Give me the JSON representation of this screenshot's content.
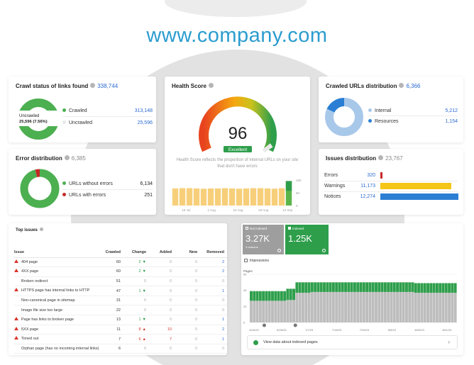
{
  "site": {
    "title": "www.company.com"
  },
  "crawl_status": {
    "title": "Crawl status of links found",
    "total": "338,744",
    "donut_label": "Uncrawled",
    "donut_value": "25,596 (7.56%)",
    "items": [
      {
        "label": "Crawled",
        "value": "313,148",
        "color": "#4caf50"
      },
      {
        "label": "Uncrawled",
        "value": "25,596",
        "color": "#e8e8e8"
      }
    ]
  },
  "health": {
    "title": "Health Score",
    "score": "96",
    "badge": "Excellent",
    "description": "Health Score reflects the proportion of internal URLs on your site that don't have errors",
    "chart_data": {
      "type": "bar",
      "values": [
        67,
        68,
        68,
        67,
        66,
        67,
        67,
        68,
        67,
        66,
        67,
        68,
        68,
        67,
        66,
        68,
        96
      ],
      "ylim": [
        0,
        100
      ],
      "yticks": [
        "100",
        "50",
        "0"
      ],
      "xticks": [
        "19 Jul",
        "1 Aug",
        "15 Aug",
        "29 Aug",
        "12 Sep"
      ]
    }
  },
  "crawled_urls": {
    "title": "Crawled URLs distribution",
    "total": "6,366",
    "items": [
      {
        "label": "Internal",
        "value": "5,212",
        "color": "#a8c8ea"
      },
      {
        "label": "Resources",
        "value": "1,154",
        "color": "#2a7fd4"
      }
    ],
    "fractions": [
      0.819,
      0.181
    ]
  },
  "error_dist": {
    "title": "Error distribution",
    "total": "6,385",
    "items": [
      {
        "label": "URLs without errors",
        "value": "6,134",
        "color": "#4caf50"
      },
      {
        "label": "URLs with errors",
        "value": "251",
        "color": "#c62828"
      }
    ],
    "fractions": [
      0.961,
      0.039
    ]
  },
  "issues_dist": {
    "title": "Issues distribution",
    "total": "23,767",
    "chart_data": {
      "type": "bar",
      "categories": [
        "Errors",
        "Warnings",
        "Notices"
      ],
      "values": [
        320,
        11173,
        12274
      ],
      "labels": [
        "320",
        "11,173",
        "12,274"
      ],
      "colors": [
        "#c62828",
        "#f5c518",
        "#2a7fd4"
      ]
    }
  },
  "top_issues": {
    "title": "Top issues",
    "columns": [
      "Issue",
      "Crawled",
      "Change",
      "Added",
      "New",
      "Removed"
    ],
    "rows": [
      {
        "issue": "404 page",
        "warn": true,
        "crawled": "60",
        "change": "2",
        "dir": "down",
        "added": "0",
        "new": "0",
        "removed": "2"
      },
      {
        "issue": "4XX page",
        "warn": true,
        "crawled": "60",
        "change": "2",
        "dir": "down",
        "added": "0",
        "new": "0",
        "removed": "2"
      },
      {
        "issue": "Broken redirect",
        "warn": false,
        "crawled": "51",
        "change": "0",
        "dir": "",
        "added": "0",
        "new": "0",
        "removed": "0"
      },
      {
        "issue": "HTTPS page has internal links to HTTP",
        "warn": true,
        "crawled": "47",
        "change": "1",
        "dir": "down",
        "added": "0",
        "new": "0",
        "removed": "1"
      },
      {
        "issue": "Non-canonical page in sitemap",
        "warn": false,
        "crawled": "31",
        "change": "0",
        "dir": "",
        "added": "0",
        "new": "0",
        "removed": "0"
      },
      {
        "issue": "Image file size too large",
        "warn": false,
        "crawled": "22",
        "change": "0",
        "dir": "",
        "added": "0",
        "new": "0",
        "removed": "0"
      },
      {
        "issue": "Page has links to broken page",
        "warn": true,
        "crawled": "13",
        "change": "1",
        "dir": "down",
        "added": "0",
        "new": "0",
        "removed": "1"
      },
      {
        "issue": "5XX page",
        "warn": true,
        "crawled": "11",
        "change": "8",
        "dir": "up",
        "added": "10",
        "new": "0",
        "removed": "2"
      },
      {
        "issue": "Timed out",
        "warn": true,
        "crawled": "7",
        "change": "6",
        "dir": "up",
        "added": "7",
        "new": "0",
        "removed": "1"
      },
      {
        "issue": "Orphan page (has no incoming internal links)",
        "warn": false,
        "crawled": "6",
        "change": "0",
        "dir": "",
        "added": "0",
        "new": "0",
        "removed": "0"
      }
    ]
  },
  "indexing": {
    "not_indexed": {
      "label": "Not indexed",
      "value": "3.27K",
      "sub": "4 reasons",
      "color": "#9e9e9e"
    },
    "indexed": {
      "label": "Indexed",
      "value": "1.25K",
      "color": "#2e9e4b"
    },
    "impressions_label": "Impressions",
    "y_axis_title": "Pages",
    "footer_link": "View data about indexed pages",
    "chart_data": {
      "type": "bar",
      "ylim": [
        0,
        60
      ],
      "yticks": [
        "60",
        "40",
        "20",
        "0"
      ],
      "xticks": [
        "6/16/23",
        "6/26/23",
        "7/7/23",
        "7/18/23",
        "7/29/23",
        "8/9/23",
        "8/20/23",
        "8/11/23"
      ],
      "series": [
        {
          "name": "Indexed",
          "color": "#2e9e4b"
        },
        {
          "name": "Not indexed",
          "color": "#bdbdbd"
        }
      ],
      "indexed": [
        12,
        12,
        12,
        12,
        12,
        12,
        12,
        12,
        12,
        12,
        12,
        12,
        14,
        14,
        14,
        13,
        13,
        13,
        13,
        13,
        12,
        12,
        12,
        12,
        12,
        12,
        12,
        12,
        12,
        12,
        12,
        12,
        12,
        12,
        12,
        12,
        12,
        12,
        12,
        12,
        12,
        12,
        12,
        12,
        12,
        12,
        12,
        12,
        12,
        12,
        12,
        12,
        12,
        12,
        12,
        12,
        12,
        12,
        12,
        12,
        12,
        12,
        12,
        12,
        12,
        12,
        12,
        12
      ],
      "not_indexed": [
        27,
        27,
        27,
        27,
        27,
        27,
        27,
        27,
        27,
        27,
        27,
        27,
        28,
        28,
        28,
        37,
        37,
        37,
        37,
        37,
        38,
        38,
        38,
        38,
        38,
        38,
        38,
        38,
        38,
        38,
        38,
        38,
        38,
        38,
        38,
        38,
        38,
        38,
        38,
        38,
        38,
        38,
        38,
        38,
        38,
        38,
        38,
        38,
        38,
        38,
        38,
        38,
        38,
        38,
        37,
        37,
        37,
        37,
        37,
        37,
        37,
        37,
        37,
        37,
        37,
        37,
        37,
        37
      ]
    }
  }
}
